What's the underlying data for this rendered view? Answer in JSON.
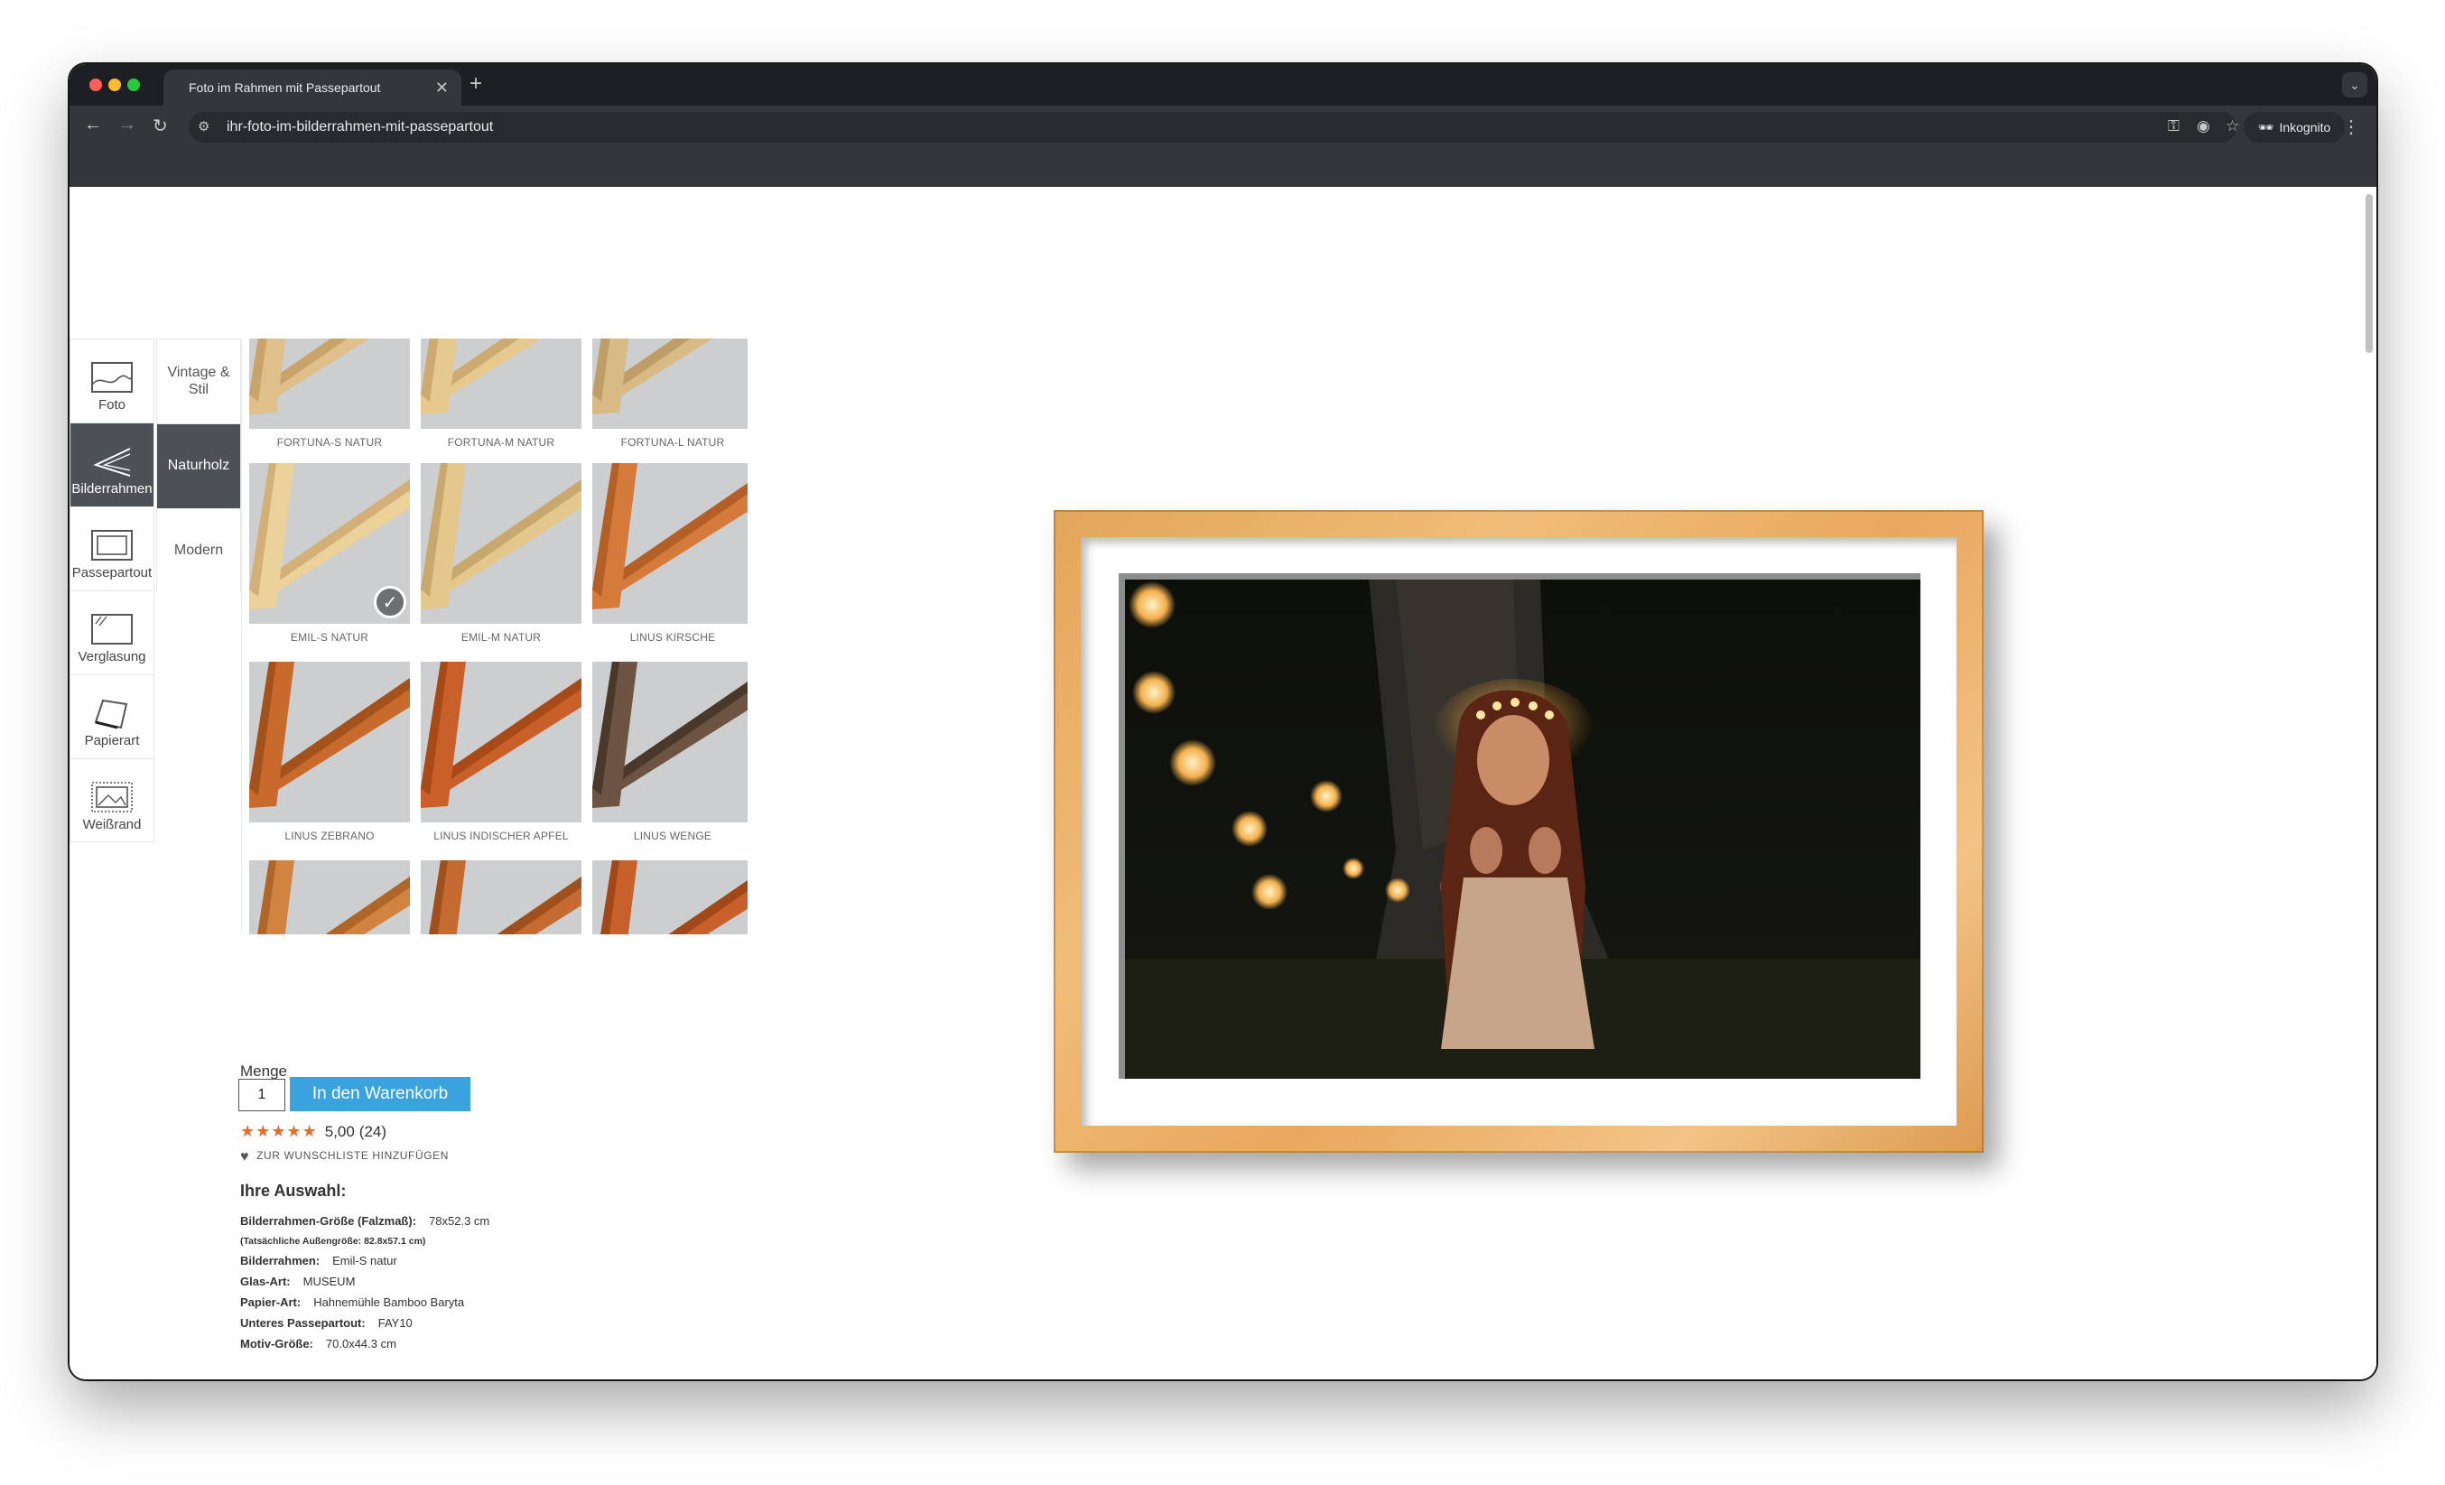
{
  "browser": {
    "tab_title": "Foto im Rahmen mit Passepartout",
    "tab_close": "✕",
    "new_tab": "+",
    "url": "ihr-foto-im-bilderrahmen-mit-passepartout",
    "profile_label": "Inkognito",
    "icons": [
      "back-icon",
      "forward-icon",
      "reload-icon",
      "site-settings-icon",
      "key-icon",
      "eye-off-icon",
      "star-icon",
      "incognito-icon",
      "kebab-icon"
    ]
  },
  "config_tabs": [
    {
      "label": "Foto"
    },
    {
      "label": "Bilderrahmen"
    },
    {
      "label": "Passepartout"
    },
    {
      "label": "Verglasung"
    },
    {
      "label": "Papierart"
    },
    {
      "label": "Weißrand"
    }
  ],
  "categories": [
    {
      "label": "Vintage & Stil"
    },
    {
      "label": "Naturholz"
    },
    {
      "label": "Modern"
    }
  ],
  "frames": [
    {
      "label": "FORTUNA-S NATUR",
      "color": "#e0c08a",
      "shade": "#c9a46a"
    },
    {
      "label": "FORTUNA-M NATUR",
      "color": "#e6c98e",
      "shade": "#cdaa70"
    },
    {
      "label": "FORTUNA-L NATUR",
      "color": "#d8ba85",
      "shade": "#bf9d66"
    },
    {
      "label": "EMIL-S NATUR",
      "color": "#ebd29a",
      "shade": "#d2b077"
    },
    {
      "label": "EMIL-M NATUR",
      "color": "#e4c78c",
      "shade": "#c8a86c"
    },
    {
      "label": "LINUS KIRSCHE",
      "color": "#d47a3a",
      "shade": "#b35f25"
    },
    {
      "label": "LINUS ZEBRANO",
      "color": "#c76a2c",
      "shade": "#a4521c"
    },
    {
      "label": "LINUS INDISCHER APFEL",
      "color": "#c9602a",
      "shade": "#a84a18"
    },
    {
      "label": "LINUS WENGE",
      "color": "#6d5342",
      "shade": "#4a382b"
    },
    {
      "label": "",
      "color": "#d08440",
      "shade": "#b06628"
    },
    {
      "label": "",
      "color": "#c56a30",
      "shade": "#a0501c"
    },
    {
      "label": "",
      "color": "#c8602c",
      "shade": "#a24818"
    }
  ],
  "product": {
    "qty_label": "Menge",
    "qty_value": "1",
    "cart_label": "In den Warenkorb",
    "stars": "★★★★★",
    "rating": "5,00",
    "rating_count": "(24)",
    "wishlist": "ZUR WUNSCHLISTE HINZUFÜGEN",
    "selection_title": "Ihre Auswahl:",
    "specs": [
      {
        "key": "Bilderrahmen-Größe (Falzmaß):",
        "value": "78x52.3 cm"
      },
      {
        "key": "(Tatsächliche Außengröße: 82.8x57.1 cm)",
        "value": ""
      },
      {
        "key": "Bilderrahmen:",
        "value": "Emil-S natur"
      },
      {
        "key": "Glas-Art:",
        "value": "MUSEUM"
      },
      {
        "key": "Papier-Art:",
        "value": "Hahnemühle Bamboo Baryta"
      },
      {
        "key": "Unteres Passepartout:",
        "value": "FAY10"
      },
      {
        "key": "Motiv-Größe:",
        "value": "70.0x44.3 cm"
      }
    ]
  },
  "colors": {
    "accent": "#3aa3de",
    "active_tab": "#4d5156",
    "star": "#e9692c",
    "frame_wood": "#e9ae66"
  }
}
